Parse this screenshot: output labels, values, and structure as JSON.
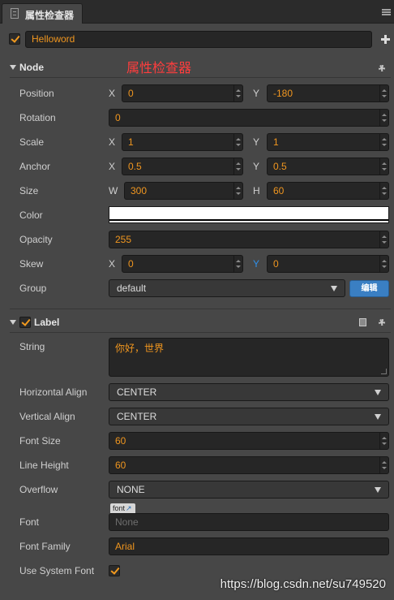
{
  "tab": {
    "title": "属性检查器",
    "icon": "inspector-icon"
  },
  "node_active": true,
  "node_name": "Helloword",
  "overlay_caption": "属性检查器",
  "colors": {
    "accent": "#f0961f",
    "caption_red": "#ff3d3d",
    "button_blue": "#3a7fc3",
    "skew_y_label": "#2f8fe8",
    "color_swatch": "#ffffff"
  },
  "node": {
    "header": "Node",
    "position": {
      "label": "Position",
      "x_label": "X",
      "x": "0",
      "y_label": "Y",
      "y": "-180"
    },
    "rotation": {
      "label": "Rotation",
      "value": "0"
    },
    "scale": {
      "label": "Scale",
      "x_label": "X",
      "x": "1",
      "y_label": "Y",
      "y": "1"
    },
    "anchor": {
      "label": "Anchor",
      "x_label": "X",
      "x": "0.5",
      "y_label": "Y",
      "y": "0.5"
    },
    "size": {
      "label": "Size",
      "w_label": "W",
      "w": "300",
      "h_label": "H",
      "h": "60"
    },
    "color": {
      "label": "Color"
    },
    "opacity": {
      "label": "Opacity",
      "value": "255"
    },
    "skew": {
      "label": "Skew",
      "x_label": "X",
      "x": "0",
      "y_label": "Y",
      "y": "0"
    },
    "group": {
      "label": "Group",
      "value": "default",
      "edit_button": "编辑"
    }
  },
  "label_component": {
    "header": "Label",
    "enabled": true,
    "string": {
      "label": "String",
      "value": "你好，世界"
    },
    "horizontal_align": {
      "label": "Horizontal Align",
      "value": "CENTER"
    },
    "vertical_align": {
      "label": "Vertical Align",
      "value": "CENTER"
    },
    "font_size": {
      "label": "Font Size",
      "value": "60"
    },
    "line_height": {
      "label": "Line Height",
      "value": "60"
    },
    "overflow": {
      "label": "Overflow",
      "value": "NONE"
    },
    "font": {
      "label": "Font",
      "tag": "font",
      "placeholder": "None"
    },
    "font_family": {
      "label": "Font Family",
      "value": "Arial"
    },
    "use_system_font": {
      "label": "Use System Font",
      "checked": true
    }
  },
  "watermark": "https://blog.csdn.net/su749520"
}
